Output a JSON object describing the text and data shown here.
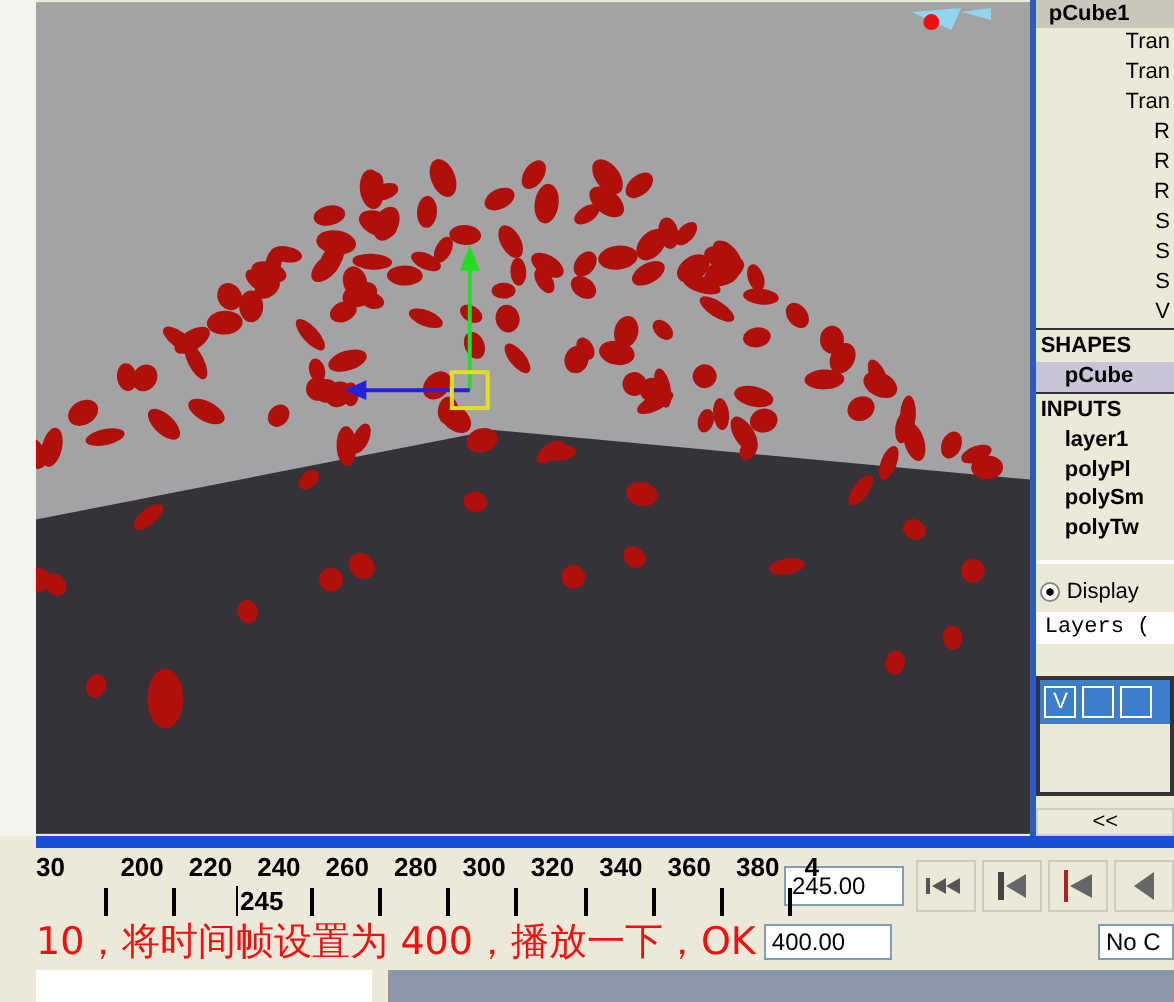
{
  "channel_box": {
    "object": "pCube1",
    "channels": [
      "Tran",
      "Tran",
      "Tran",
      "R",
      "R",
      "R",
      "S",
      "S",
      "S",
      "V"
    ],
    "shapes_header": "SHAPES",
    "shapes": [
      {
        "label": "pCube",
        "selected": true
      }
    ],
    "inputs_header": "INPUTS",
    "inputs": [
      "layer1",
      "polyPl",
      "polySm",
      "polyTw"
    ]
  },
  "layer_editor": {
    "mode_label": "Display",
    "mode_selected": true,
    "menu": "Layers (",
    "layers": [
      {
        "visible_label": "V",
        "selected": true
      }
    ],
    "collapse_button": "<<"
  },
  "time_slider": {
    "ticks": [
      "30",
      "200",
      "220",
      "240",
      "260",
      "280",
      "300",
      "320",
      "340",
      "360",
      "380",
      "4"
    ],
    "current_frame": "245",
    "current_time": "245.00"
  },
  "range_slider": {
    "end_time": "400.00",
    "character_set": "No C"
  },
  "caption": "10，将时间帧设置为 400，播放一下，OK"
}
